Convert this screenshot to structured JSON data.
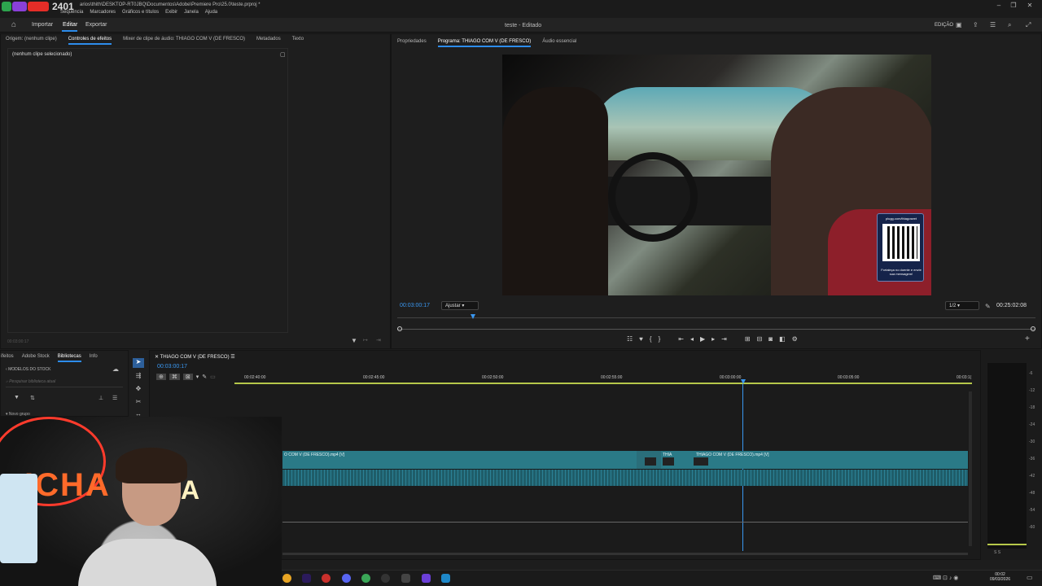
{
  "titlebar": {
    "badge": "2401",
    "path": "arios\\thith\\DESKTOP-RT0JBQ\\Documentos\\Adobe\\Premiere Pro\\25.0\\teste.prproj *",
    "menus": [
      "Sequência",
      "Marcadores",
      "Gráficos e títulos",
      "Exibir",
      "Janela",
      "Ajuda"
    ]
  },
  "appbar": {
    "tabs": [
      "Importar",
      "Editar",
      "Exportar"
    ],
    "active_tab": "Editar",
    "document_title": "teste - Editado",
    "workspace": "EDIÇÃO"
  },
  "effects_panel": {
    "tabs": [
      "Origem: (nenhum clipe)",
      "Controles de efeitos",
      "Mixer de clipe de áudio: THIAGO COM V (DE FRESCO)",
      "Metadados",
      "Texto"
    ],
    "active_tab": "Controles de efeitos",
    "empty_label": "(nenhum clipe selecionado)",
    "timecode": "00:03:00:17"
  },
  "program_panel": {
    "tabs": [
      "Propriedades",
      "Programa: THIAGO COM V (DE FRESCO)",
      "Áudio essencial"
    ],
    "active_tab": "Programa: THIAGO COM V (DE FRESCO)",
    "timecode": "00:03:00:17",
    "fit": "Ajustar",
    "resolution": "1/2",
    "duration": "00:25:02:08",
    "qr_top": "plugg.com/thiagoseet",
    "qr_bottom": "Fortaleça no doente e envie sua mensagem!"
  },
  "libraries_panel": {
    "tabs": [
      "ifeitos",
      "Adobe Stock",
      "Bibliotecas",
      "Info"
    ],
    "active_tab": "Bibliotecas",
    "section": "MODELOS DO STOCK",
    "search_placeholder": "Pesquisar biblioteca atual",
    "group": "Novo grupo"
  },
  "timeline": {
    "sequence_name": "THIAGO COM V (DE FRESCO)",
    "timecode": "00:03:00:17",
    "ruler": [
      "00:02:40:00",
      "00:02:45:00",
      "00:02:50:00",
      "00:02:55:00",
      "00:03:00:00",
      "00:03:05:00",
      "00:03:1("
    ],
    "clips": [
      {
        "label": "O COM V (DE FRESCO).mp4 [V]"
      },
      {
        "label": "THIA"
      },
      {
        "label": "THIAGO COM V (DE FRESCO).mp4 [V]"
      }
    ]
  },
  "audio_meter": {
    "labels": [
      "-6",
      "-12",
      "-18",
      "-24",
      "-30",
      "-36",
      "-42",
      "-48",
      "-54",
      "-60"
    ],
    "footer": "S  S"
  },
  "webcam": {
    "sign_left": "ICHA",
    "sign_right": "RIA"
  },
  "taskbar": {
    "time": "00:02",
    "date": "09/03/2026"
  },
  "colors": {
    "accent": "#2d8ceb",
    "clip": "#2a7a87",
    "timecode": "#3a97f0"
  }
}
